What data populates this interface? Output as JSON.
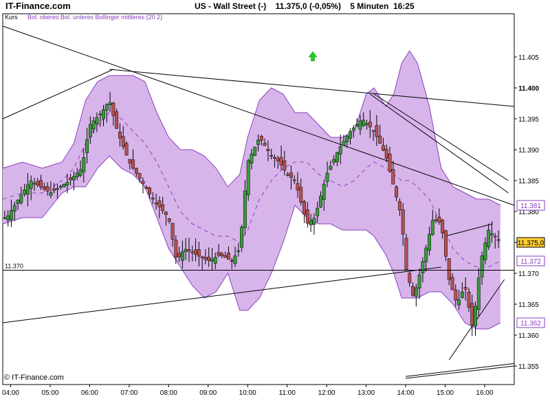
{
  "header": {
    "brand": "IT-Finance.com",
    "title": "US - Wall Street (-)    11.375,0 (-0,05%)    5 Minuten  16:25"
  },
  "legend": {
    "kurs": "Kurs",
    "bollinger": "Bol. oberes Bol. unteres Bollinger mittleres (20 2)"
  },
  "footer": {
    "copyright": "© IT-Finance.com"
  },
  "colors": {
    "band_fill": "#d7b5ea",
    "band_line": "#8a3ec0",
    "candle_up": "#3a9a3a",
    "candle_down": "#b85050",
    "price_box": "#ffcc33",
    "arrow": "#22cc22"
  },
  "icons": {
    "trend_arrow": "green-up-arrow-icon"
  },
  "chart_data": {
    "type": "candlestick",
    "interval": "5 Minuten",
    "ylim": [
      11352,
      11412
    ],
    "yticks": [
      "11.355",
      "11.360",
      "11.365",
      "11.370",
      "11.375",
      "11.380",
      "11.385",
      "11.390",
      "11.395",
      "11.400",
      "11.405"
    ],
    "ytick_values": [
      11355,
      11360,
      11365,
      11370,
      11375,
      11380,
      11385,
      11390,
      11395,
      11400,
      11405
    ],
    "xlim": [
      3.8,
      16.75
    ],
    "xticks": [
      "04:00",
      "05:00",
      "06:00",
      "07:00",
      "08:00",
      "09:00",
      "10:00",
      "11:00",
      "12:00",
      "13:00",
      "14:00",
      "15:00",
      "16:00"
    ],
    "xtick_values": [
      4,
      5,
      6,
      7,
      8,
      9,
      10,
      11,
      12,
      13,
      14,
      15,
      16
    ],
    "grid": false,
    "reference_line": {
      "value": 11370.5,
      "label": "11.370"
    },
    "last_price": {
      "value": 11375,
      "label": "11.375,0"
    },
    "upper_band_last": {
      "value": 11381,
      "label": "11.381"
    },
    "middle_band_last": {
      "value": 11372,
      "label": "11.372"
    },
    "lower_band_last": {
      "value": 11362,
      "label": "11.362"
    },
    "close_x": [
      3.9,
      4.5,
      5.0,
      5.5,
      5.8,
      6.0,
      6.3,
      6.5,
      6.7,
      7.0,
      7.3,
      7.6,
      8.0,
      8.2,
      8.4,
      8.7,
      9.0,
      9.3,
      9.6,
      9.8,
      10.0,
      10.3,
      10.6,
      10.8,
      11.0,
      11.2,
      11.5,
      11.7,
      12.0,
      12.3,
      12.6,
      12.9,
      13.2,
      13.5,
      13.7,
      13.9,
      14.0,
      14.2,
      14.4,
      14.7,
      14.9,
      15.1,
      15.3,
      15.5,
      15.7,
      15.9,
      16.1,
      16.4
    ],
    "close_y": [
      11379,
      11385,
      11383,
      11385,
      11387,
      11394,
      11396,
      11398,
      11393,
      11388,
      11385,
      11382,
      11379,
      11372,
      11374,
      11373,
      11372,
      11373,
      11372,
      11374,
      11388,
      11392,
      11389,
      11388,
      11386,
      11385,
      11378,
      11379,
      11386,
      11390,
      11393,
      11395,
      11393,
      11389,
      11384,
      11379,
      11371,
      11366,
      11371,
      11379,
      11378,
      11369,
      11365,
      11368,
      11361,
      11372,
      11377,
      11375
    ],
    "upper_band_x": [
      3.8,
      4.3,
      4.8,
      5.3,
      5.6,
      5.9,
      6.2,
      6.5,
      6.8,
      7.1,
      7.4,
      7.7,
      8.0,
      8.3,
      8.6,
      8.9,
      9.2,
      9.5,
      9.8,
      10.0,
      10.3,
      10.6,
      10.9,
      11.2,
      11.5,
      11.8,
      12.1,
      12.4,
      12.7,
      13.0,
      13.2,
      13.5,
      13.7,
      13.9,
      14.1,
      14.3,
      14.6,
      14.9,
      15.2,
      15.5,
      15.8,
      16.1,
      16.4
    ],
    "upper_band_y": [
      11387,
      11388,
      11387,
      11388,
      11391,
      11398,
      11401,
      11402,
      11402,
      11402,
      11401,
      11396,
      11392,
      11390,
      11390,
      11389,
      11387,
      11384,
      11386,
      11392,
      11398,
      11400,
      11399,
      11396,
      11396,
      11394,
      11392,
      11392,
      11393,
      11399,
      11400,
      11397,
      11399,
      11404,
      11406,
      11404,
      11397,
      11387,
      11384,
      11383,
      11382,
      11382,
      11381
    ],
    "lower_band_x": [
      3.8,
      4.3,
      4.8,
      5.3,
      5.6,
      5.9,
      6.2,
      6.5,
      6.8,
      7.1,
      7.4,
      7.7,
      8.0,
      8.3,
      8.6,
      8.9,
      9.2,
      9.5,
      9.8,
      10.0,
      10.3,
      10.6,
      10.9,
      11.2,
      11.5,
      11.8,
      12.1,
      12.4,
      12.7,
      13.0,
      13.2,
      13.5,
      13.7,
      13.9,
      14.1,
      14.3,
      14.6,
      14.9,
      15.2,
      15.5,
      15.8,
      16.1,
      16.4
    ],
    "lower_band_y": [
      11378,
      11379,
      11379,
      11383,
      11384,
      11384,
      11387,
      11389,
      11387,
      11386,
      11384,
      11379,
      11374,
      11371,
      11368,
      11366,
      11367,
      11370,
      11364,
      11364,
      11366,
      11370,
      11375,
      11381,
      11379,
      11378,
      11378,
      11377,
      11377,
      11377,
      11376,
      11373,
      11370,
      11366,
      11366,
      11366,
      11367,
      11367,
      11365,
      11362,
      11361,
      11361,
      11362
    ],
    "middle_band_x": [
      3.8,
      4.3,
      4.8,
      5.3,
      5.6,
      5.9,
      6.2,
      6.5,
      6.8,
      7.1,
      7.4,
      7.7,
      8.0,
      8.3,
      8.6,
      8.9,
      9.2,
      9.5,
      9.8,
      10.0,
      10.3,
      10.6,
      10.9,
      11.2,
      11.5,
      11.8,
      12.1,
      12.4,
      12.7,
      13.0,
      13.2,
      13.5,
      13.7,
      13.9,
      14.1,
      14.3,
      14.6,
      14.9,
      15.2,
      15.5,
      15.8,
      16.1,
      16.4
    ],
    "middle_band_y": [
      11382,
      11383,
      11383,
      11385,
      11387,
      11391,
      11394,
      11396,
      11395,
      11393,
      11391,
      11388,
      11384,
      11380,
      11378,
      11377,
      11376,
      11376,
      11375,
      11377,
      11382,
      11385,
      11387,
      11388,
      11388,
      11386,
      11385,
      11384,
      11385,
      11387,
      11388,
      11387,
      11386,
      11385,
      11385,
      11384,
      11382,
      11378,
      11374,
      11372,
      11371,
      11371,
      11372
    ],
    "trendlines": [
      {
        "x": [
          3.8,
          6.6
        ],
        "y": [
          11395,
          11403
        ]
      },
      {
        "x": [
          3.8,
          16.75
        ],
        "y": [
          11410,
          11381
        ]
      },
      {
        "x": [
          6.5,
          16.75
        ],
        "y": [
          11403,
          11397
        ]
      },
      {
        "x": [
          3.8,
          14.9
        ],
        "y": [
          11362,
          11371
        ]
      },
      {
        "x": [
          13.1,
          16.6
        ],
        "y": [
          11399,
          11383
        ]
      },
      {
        "x": [
          13.2,
          16.6
        ],
        "y": [
          11399,
          11385
        ]
      },
      {
        "x": [
          15.1,
          16.5
        ],
        "y": [
          11356,
          11369
        ]
      },
      {
        "x": [
          15.0,
          16.2
        ],
        "y": [
          11376,
          11378
        ]
      },
      {
        "x": [
          14.0,
          16.75
        ],
        "y": [
          11353,
          11355
        ]
      },
      {
        "x": [
          14.0,
          16.75
        ],
        "y": [
          11353.3,
          11355.4
        ]
      }
    ],
    "signal_arrow": {
      "x": 11.65,
      "y": 11405
    }
  }
}
